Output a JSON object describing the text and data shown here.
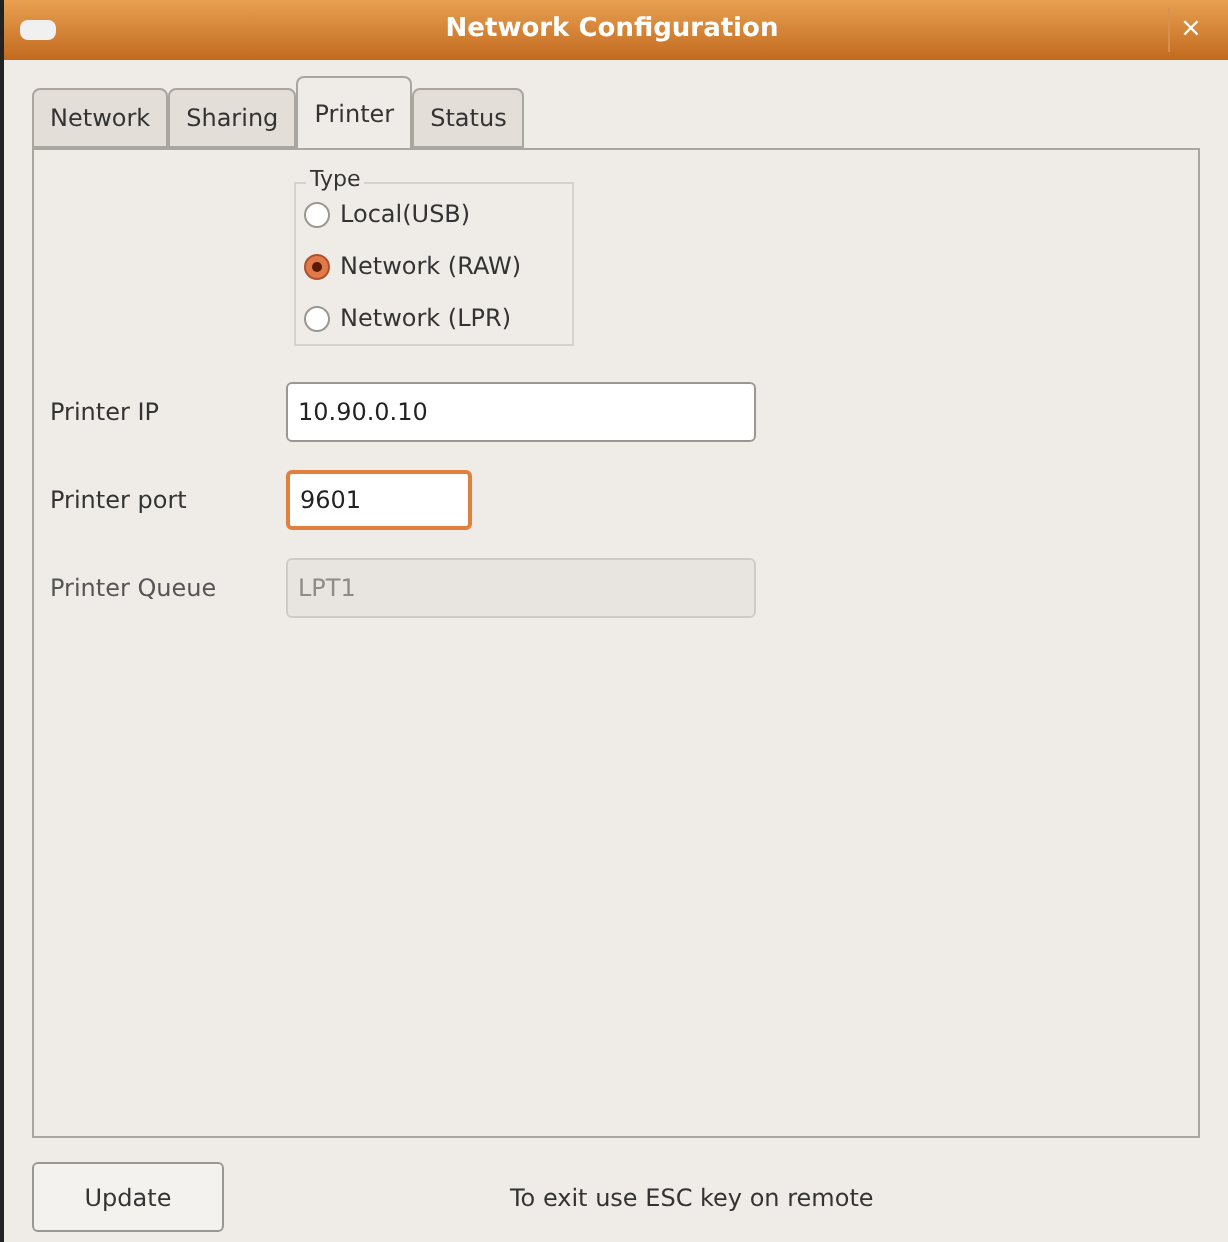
{
  "window": {
    "title": "Network Configuration",
    "close": "×"
  },
  "tabs": [
    {
      "label": "Network",
      "selected": false
    },
    {
      "label": "Sharing",
      "selected": false
    },
    {
      "label": "Printer",
      "selected": true
    },
    {
      "label": "Status",
      "selected": false
    }
  ],
  "type_group": {
    "title": "Type",
    "options": [
      {
        "label": "Local(USB)",
        "selected": false
      },
      {
        "label": "Network (RAW)",
        "selected": true
      },
      {
        "label": "Network (LPR)",
        "selected": false
      }
    ]
  },
  "fields": [
    {
      "label": "Printer IP",
      "value": "10.90.0.10",
      "focused": false,
      "disabled": false,
      "kind": "wide"
    },
    {
      "label": "Printer port",
      "value": "9601",
      "focused": true,
      "disabled": false,
      "kind": "narrow"
    },
    {
      "label": "Printer Queue",
      "value": "LPT1",
      "focused": false,
      "disabled": true,
      "kind": "wide"
    }
  ],
  "update_button": "Update",
  "hint": "To exit use ESC key on remote"
}
